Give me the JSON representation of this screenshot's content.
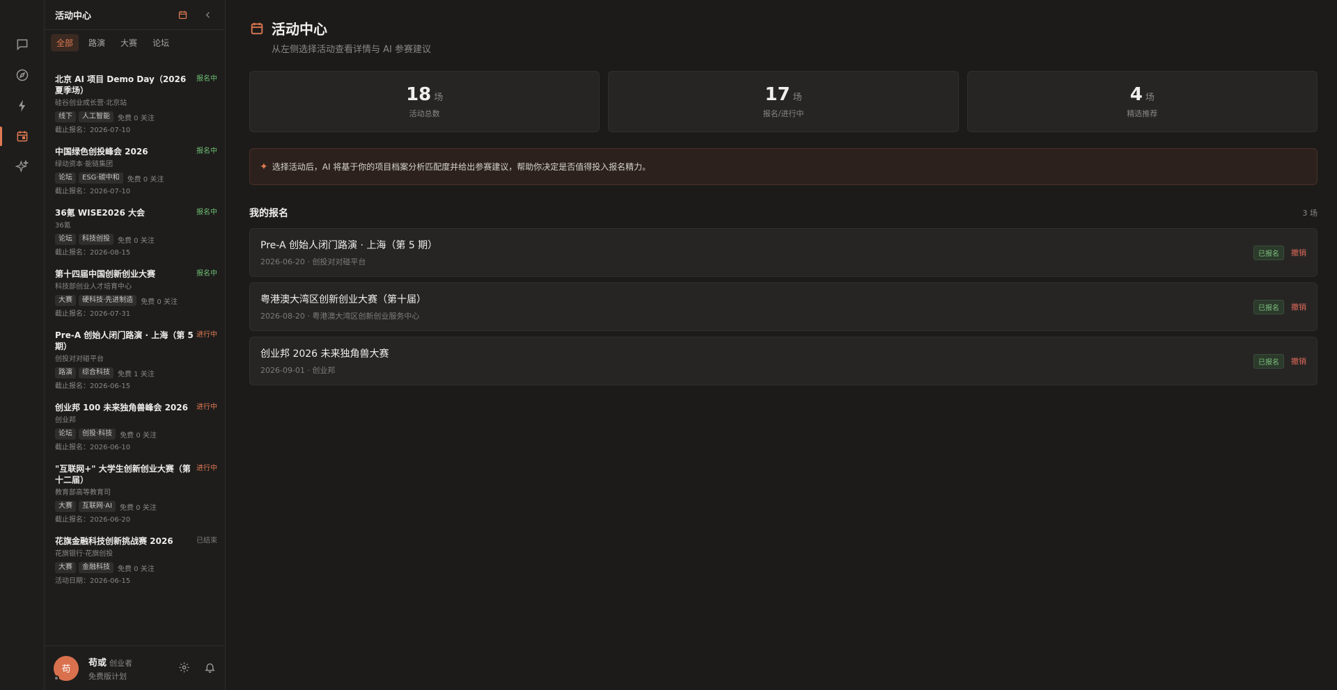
{
  "rail": {
    "items": [
      {
        "icon": "chat-icon"
      },
      {
        "icon": "compass-icon"
      },
      {
        "icon": "lightning-icon"
      },
      {
        "icon": "calendar-icon",
        "active": true
      },
      {
        "icon": "sparkles-icon"
      }
    ]
  },
  "sidebar": {
    "title": "活动中心",
    "tabs": [
      {
        "label": "全部",
        "active": true
      },
      {
        "label": "路演"
      },
      {
        "label": "大赛"
      },
      {
        "label": "论坛"
      }
    ],
    "events": [
      {
        "title": "北京 AI 项目 Demo Day（2026 夏季场）",
        "status": "报名中",
        "status_type": "open",
        "org": "硅谷创业成长营·北京站",
        "tags": [
          "线下",
          "人工智能"
        ],
        "meta": "免费 0 关注",
        "deadline": "截止报名：2026-07-10"
      },
      {
        "title": "中国绿色创投峰会 2026",
        "status": "报名中",
        "status_type": "open",
        "org": "绿动资本·能链集团",
        "tags": [
          "论坛",
          "ESG·碳中和"
        ],
        "meta": "免费 0 关注",
        "deadline": "截止报名：2026-07-10"
      },
      {
        "title": "36氪 WISE2026 大会",
        "status": "报名中",
        "status_type": "open",
        "org": "36氪",
        "tags": [
          "论坛",
          "科技创投"
        ],
        "meta": "免费 0 关注",
        "deadline": "截止报名：2026-08-15"
      },
      {
        "title": "第十四届中国创新创业大赛",
        "status": "报名中",
        "status_type": "open",
        "org": "科技部创业人才培育中心",
        "tags": [
          "大赛",
          "硬科技·先进制造"
        ],
        "meta": "免费 0 关注",
        "deadline": "截止报名：2026-07-31"
      },
      {
        "title": "Pre-A 创始人闭门路演 · 上海（第 5 期）",
        "status": "进行中",
        "status_type": "going",
        "org": "创投对对碰平台",
        "tags": [
          "路演",
          "综合科技"
        ],
        "meta": "免费 1 关注",
        "deadline": "截止报名：2026-06-15"
      },
      {
        "title": "创业邦 100 未来独角兽峰会 2026",
        "status": "进行中",
        "status_type": "going",
        "org": "创业邦",
        "tags": [
          "论坛",
          "创投·科技"
        ],
        "meta": "免费 0 关注",
        "deadline": "截止报名：2026-06-10"
      },
      {
        "title": "\"互联网+\" 大学生创新创业大赛（第十二届）",
        "status": "进行中",
        "status_type": "going",
        "org": "教育部高等教育司",
        "tags": [
          "大赛",
          "互联网·AI"
        ],
        "meta": "免费 0 关注",
        "deadline": "截止报名：2026-06-20"
      },
      {
        "title": "花旗金融科技创新挑战赛 2026",
        "status": "已结束",
        "status_type": "ended",
        "org": "花旗银行·花旗创投",
        "tags": [
          "大赛",
          "金融科技"
        ],
        "meta": "免费 0 关注",
        "deadline": "活动日期：2026-06-15"
      }
    ],
    "user": {
      "avatar_char": "苟",
      "name": "苟或",
      "role": "创业者",
      "plan": "免费版计划"
    }
  },
  "main": {
    "title": "活动中心",
    "subtitle": "从左侧选择活动查看详情与 AI 参赛建议",
    "stats": [
      {
        "num": "18",
        "unit": "场",
        "label": "活动总数"
      },
      {
        "num": "17",
        "unit": "场",
        "label": "报名/进行中"
      },
      {
        "num": "4",
        "unit": "场",
        "label": "精选推荐"
      }
    ],
    "ai_banner": "选择活动后，AI 将基于你的项目档案分析匹配度并给出参赛建议，帮助你决定是否值得投入报名精力。",
    "my_reg": {
      "title": "我的报名",
      "count": "3 场",
      "items": [
        {
          "title": "Pre-A 创始人闭门路演 · 上海（第 5 期）",
          "sub": "2026-06-20 · 创投对对碰平台",
          "badge": "已报名",
          "action": "撤销"
        },
        {
          "title": "粤港澳大湾区创新创业大赛（第十届）",
          "sub": "2026-08-20 · 粤港澳大湾区创新创业服务中心",
          "badge": "已报名",
          "action": "撤销"
        },
        {
          "title": "创业邦 2026 未来独角兽大赛",
          "sub": "2026-09-01 · 创业邦",
          "badge": "已报名",
          "action": "撤销"
        }
      ]
    }
  },
  "colors": {
    "accent": "#e07a52",
    "open": "#6fbf73",
    "danger": "#e06a5a"
  }
}
